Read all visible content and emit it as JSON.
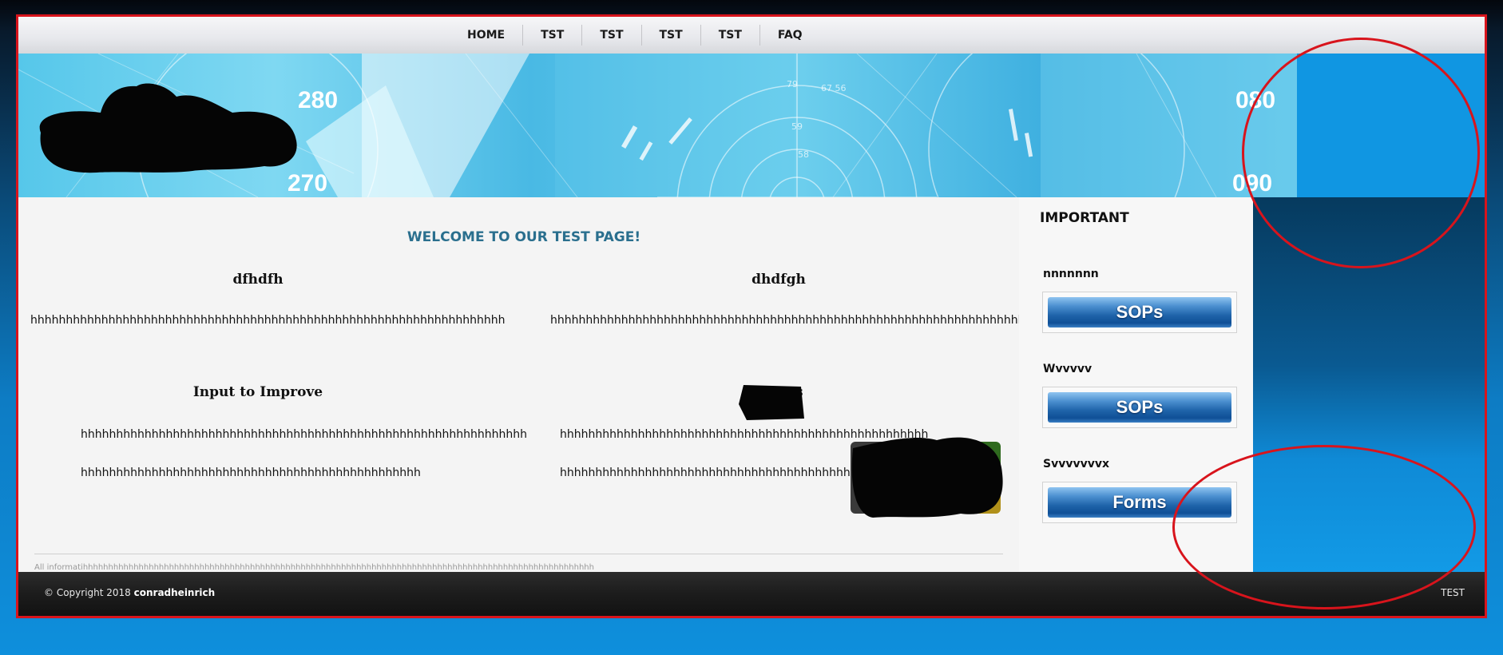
{
  "nav": {
    "items": [
      "HOME",
      "TST",
      "TST",
      "TST",
      "TST",
      "FAQ"
    ]
  },
  "banner": {
    "numbers": [
      "280",
      "270",
      "080",
      "090",
      "79",
      "67 56",
      "59",
      "58"
    ]
  },
  "main": {
    "welcome": "WELCOME TO OUR TEST PAGE!",
    "col1_title": "dfhdfh",
    "col1_text": "hhhhhhhhhhhhhhhhhhhhhhhhhhhhhhhhhhhhhhhhhhhhhhhhhhhhhhhhhhhhhhhhhhh",
    "col2_title": "dhdfgh",
    "col2_text": "hhhhhhhhhhhhhhhhhhhhhhhhhhhhhhhhhhhhhhhhhhhhhhhhhhhhhhhhhhhhhhhhhhhh",
    "col3_title": "Input to Improve",
    "col3_line1": "hhhhhhhhhhhhhhhhhhhhhhhhhhhhhhhhhhhhhhhhhhhhhhhhhhhhhhhhhhhhhhh",
    "col3_line2": "hhhhhhhhhhhhhhhhhhhhhhhhhhhhhhhhhhhhhhhhhhhhhhhh",
    "col4_title_partial": "s",
    "col4_line1": "hhhhhhhhhhhhhhhhhhhhhhhhhhhhhhhhhhhhhhhhhhhhhhhhhhhh",
    "col4_line2": "hhhhhhhhhhhhhhhhhhhhhhhhhhhhhhhhhhhhhhhhhhhhhhhhh",
    "footnote": "All informatihhhhhhhhhhhhhhhhhhhhhhhhhhhhhhhhhhhhhhhhhhhhhhhhhhhhhhhhhhhhhhhhhhhhhhhhhhhhhhhhhhhhhhhhhhhhhhhhhhhhh"
  },
  "sidebar": {
    "heading": "IMPORTANT",
    "sections": [
      {
        "label": "nnnnnnn",
        "button": "SOPs"
      },
      {
        "label": "Wvvvvv",
        "button": "SOPs"
      },
      {
        "label": "Svvvvvvvx",
        "button": "Forms"
      }
    ]
  },
  "footer": {
    "copyright_prefix": "© Copyright 2018 ",
    "copyright_name": "conradheinrich",
    "right": "TEST"
  },
  "colors": {
    "annotation_red": "#d8141c",
    "welcome_color": "#2a6f8e",
    "button_blue": "#1f64aa"
  }
}
